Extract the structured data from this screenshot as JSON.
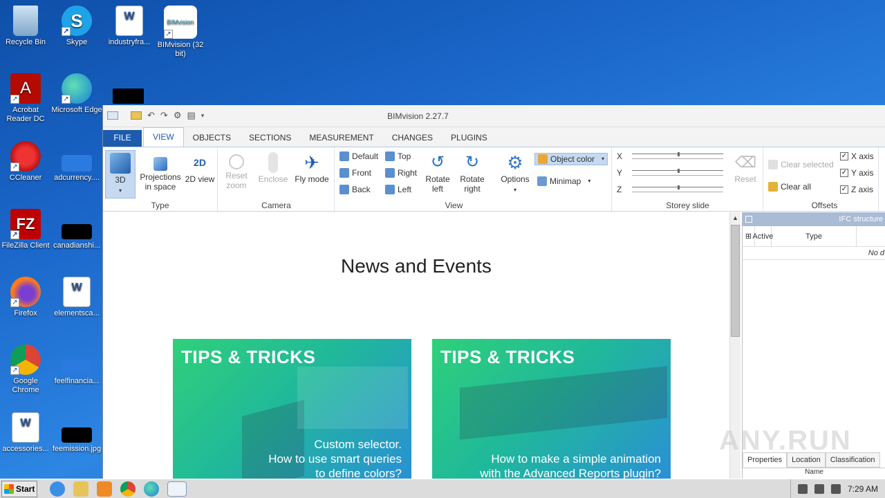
{
  "desktop": {
    "icons": [
      {
        "label": "Recycle Bin"
      },
      {
        "label": "Skype"
      },
      {
        "label": "industryfra..."
      },
      {
        "label": "BIMvision (32 bit)"
      },
      {
        "label": "Acrobat Reader DC"
      },
      {
        "label": "Microsoft Edge"
      },
      {
        "label": "CCleaner"
      },
      {
        "label": "adcurrency...."
      },
      {
        "label": "FileZilla Client"
      },
      {
        "label": "canadianshi..."
      },
      {
        "label": "Firefox"
      },
      {
        "label": "elementsca..."
      },
      {
        "label": "Google Chrome"
      },
      {
        "label": "feelfinancia..."
      },
      {
        "label": "accessories..."
      },
      {
        "label": "feemission.jpg"
      }
    ]
  },
  "window": {
    "title": "BIMvision 2.27.7",
    "tabs": [
      "FILE",
      "VIEW",
      "OBJECTS",
      "SECTIONS",
      "MEASUREMENT",
      "CHANGES",
      "PLUGINS"
    ],
    "active_tab": "VIEW"
  },
  "ribbon": {
    "type": {
      "title": "Type",
      "btn_3d": "3D",
      "btn_projections": "Projections in space",
      "btn_2d": "2D view"
    },
    "camera": {
      "title": "Camera",
      "reset_zoom": "Reset zoom",
      "enclose": "Enclose",
      "fly_mode": "Fly mode"
    },
    "view": {
      "title": "View",
      "default": "Default",
      "front": "Front",
      "back": "Back",
      "top": "Top",
      "right": "Right",
      "left": "Left",
      "rotate_left": "Rotate left",
      "rotate_right": "Rotate right",
      "options": "Options",
      "object_color": "Object color",
      "minimap": "Minimap"
    },
    "storey": {
      "title": "Storey slide",
      "x": "X",
      "y": "Y",
      "z": "Z",
      "reset": "Reset"
    },
    "offsets": {
      "title": "Offsets",
      "clear_selected": "Clear selected",
      "clear_all": "Clear all",
      "x_axis": "X axis",
      "y_axis": "Y axis",
      "z_axis": "Z axis"
    }
  },
  "content": {
    "heading": "News and Events",
    "cards": [
      {
        "title": "TIPS & TRICKS",
        "body": "Custom selector.\nHow to use smart queries\nto define colors?"
      },
      {
        "title": "TIPS & TRICKS",
        "body": "How to make a simple animation\nwith the Advanced Reports plugin?"
      }
    ]
  },
  "panel": {
    "header": "IFC structure",
    "col_active": "Active",
    "col_type": "Type",
    "empty": "No d",
    "tabs": [
      "Properties",
      "Location",
      "Classification"
    ],
    "name_col": "Name"
  },
  "taskbar": {
    "start": "Start",
    "time": "7:29 AM"
  },
  "watermark": "ANY.RUN",
  "colors": {
    "accent": "#1c5bad",
    "card_green": "#2fd07a",
    "card_blue": "#2a8fd6",
    "desktop_blue": "#1a66c9"
  }
}
